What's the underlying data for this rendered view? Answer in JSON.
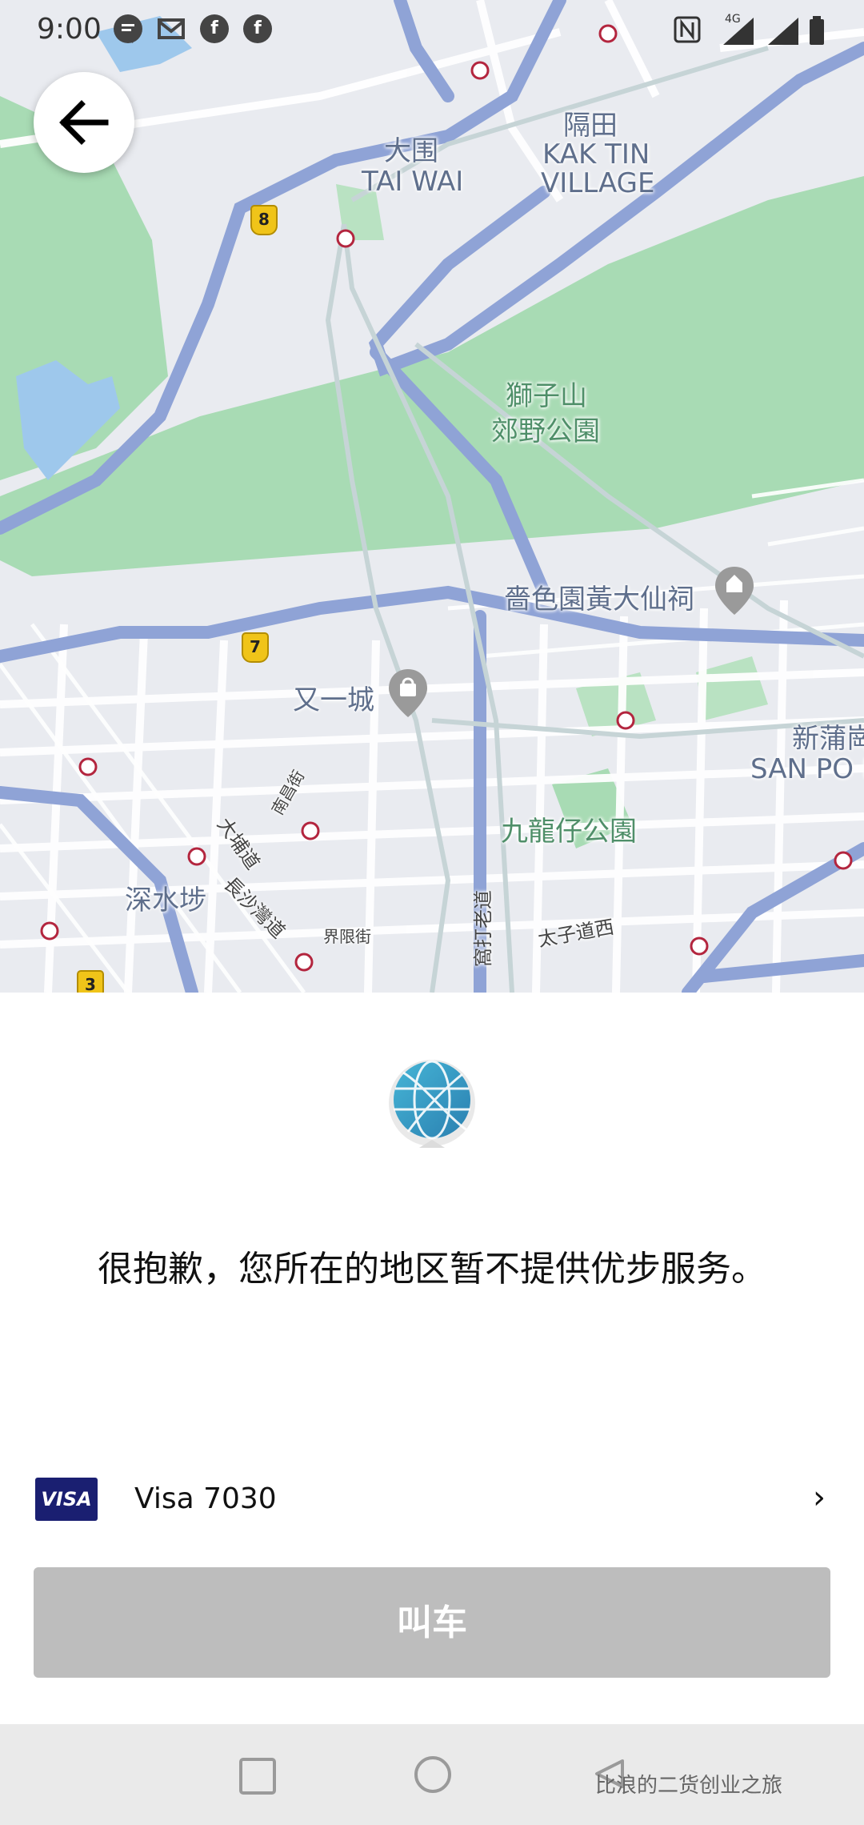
{
  "status_bar": {
    "time": "9:00",
    "left_icons": [
      "message-icon",
      "gmail-icon",
      "facebook-icon",
      "facebook-icon"
    ],
    "right_icons": [
      "nfc-icon",
      "signal-4g-icon",
      "signal-roaming-icon",
      "battery-icon"
    ],
    "network_label": "4G"
  },
  "map": {
    "labels": {
      "tai_wai_cn": "大围",
      "tai_wai_en": "TAI WAI",
      "kak_tin_cn": "隔田",
      "kak_tin_en": "KAK TIN",
      "kak_tin_en2": "VILLAGE",
      "lion_rock_1": "獅子山",
      "lion_rock_2": "郊野公園",
      "wong_tai_sin": "嗇色園黃大仙祠",
      "festival_walk": "又一城",
      "san_po_kong_cn": "新蒲崗",
      "san_po_kong_en": "SAN PO KO",
      "kowloon_tsai_park": "九龍仔公園",
      "sham_shui_po": "深水埗",
      "tai_po_road": "大埔道",
      "cheung_sha_wan_road": "長沙灣道",
      "nam_cheong_st": "南昌街",
      "boundary_st": "界限街",
      "waterloo_rd": "窩打老道",
      "prince_edward_rd": "太子道西"
    },
    "route_shields": [
      "8",
      "7",
      "3"
    ]
  },
  "sheet": {
    "icon": "globe-icon",
    "message": "很抱歉，您所在的地区暂不提供优步服务。",
    "payment": {
      "card_brand": "VISA",
      "label": "Visa 7030",
      "chevron": "›"
    },
    "request_button": "叫车"
  },
  "nav_bar": {
    "watermark": "比浪的二货创业之旅"
  },
  "colors": {
    "map_bg": "#e9ebf0",
    "park_green": "#a8dbb4",
    "road_blue": "#8fa3d6",
    "button_disabled": "#bdbdbd",
    "visa_blue": "#1a1f71"
  }
}
